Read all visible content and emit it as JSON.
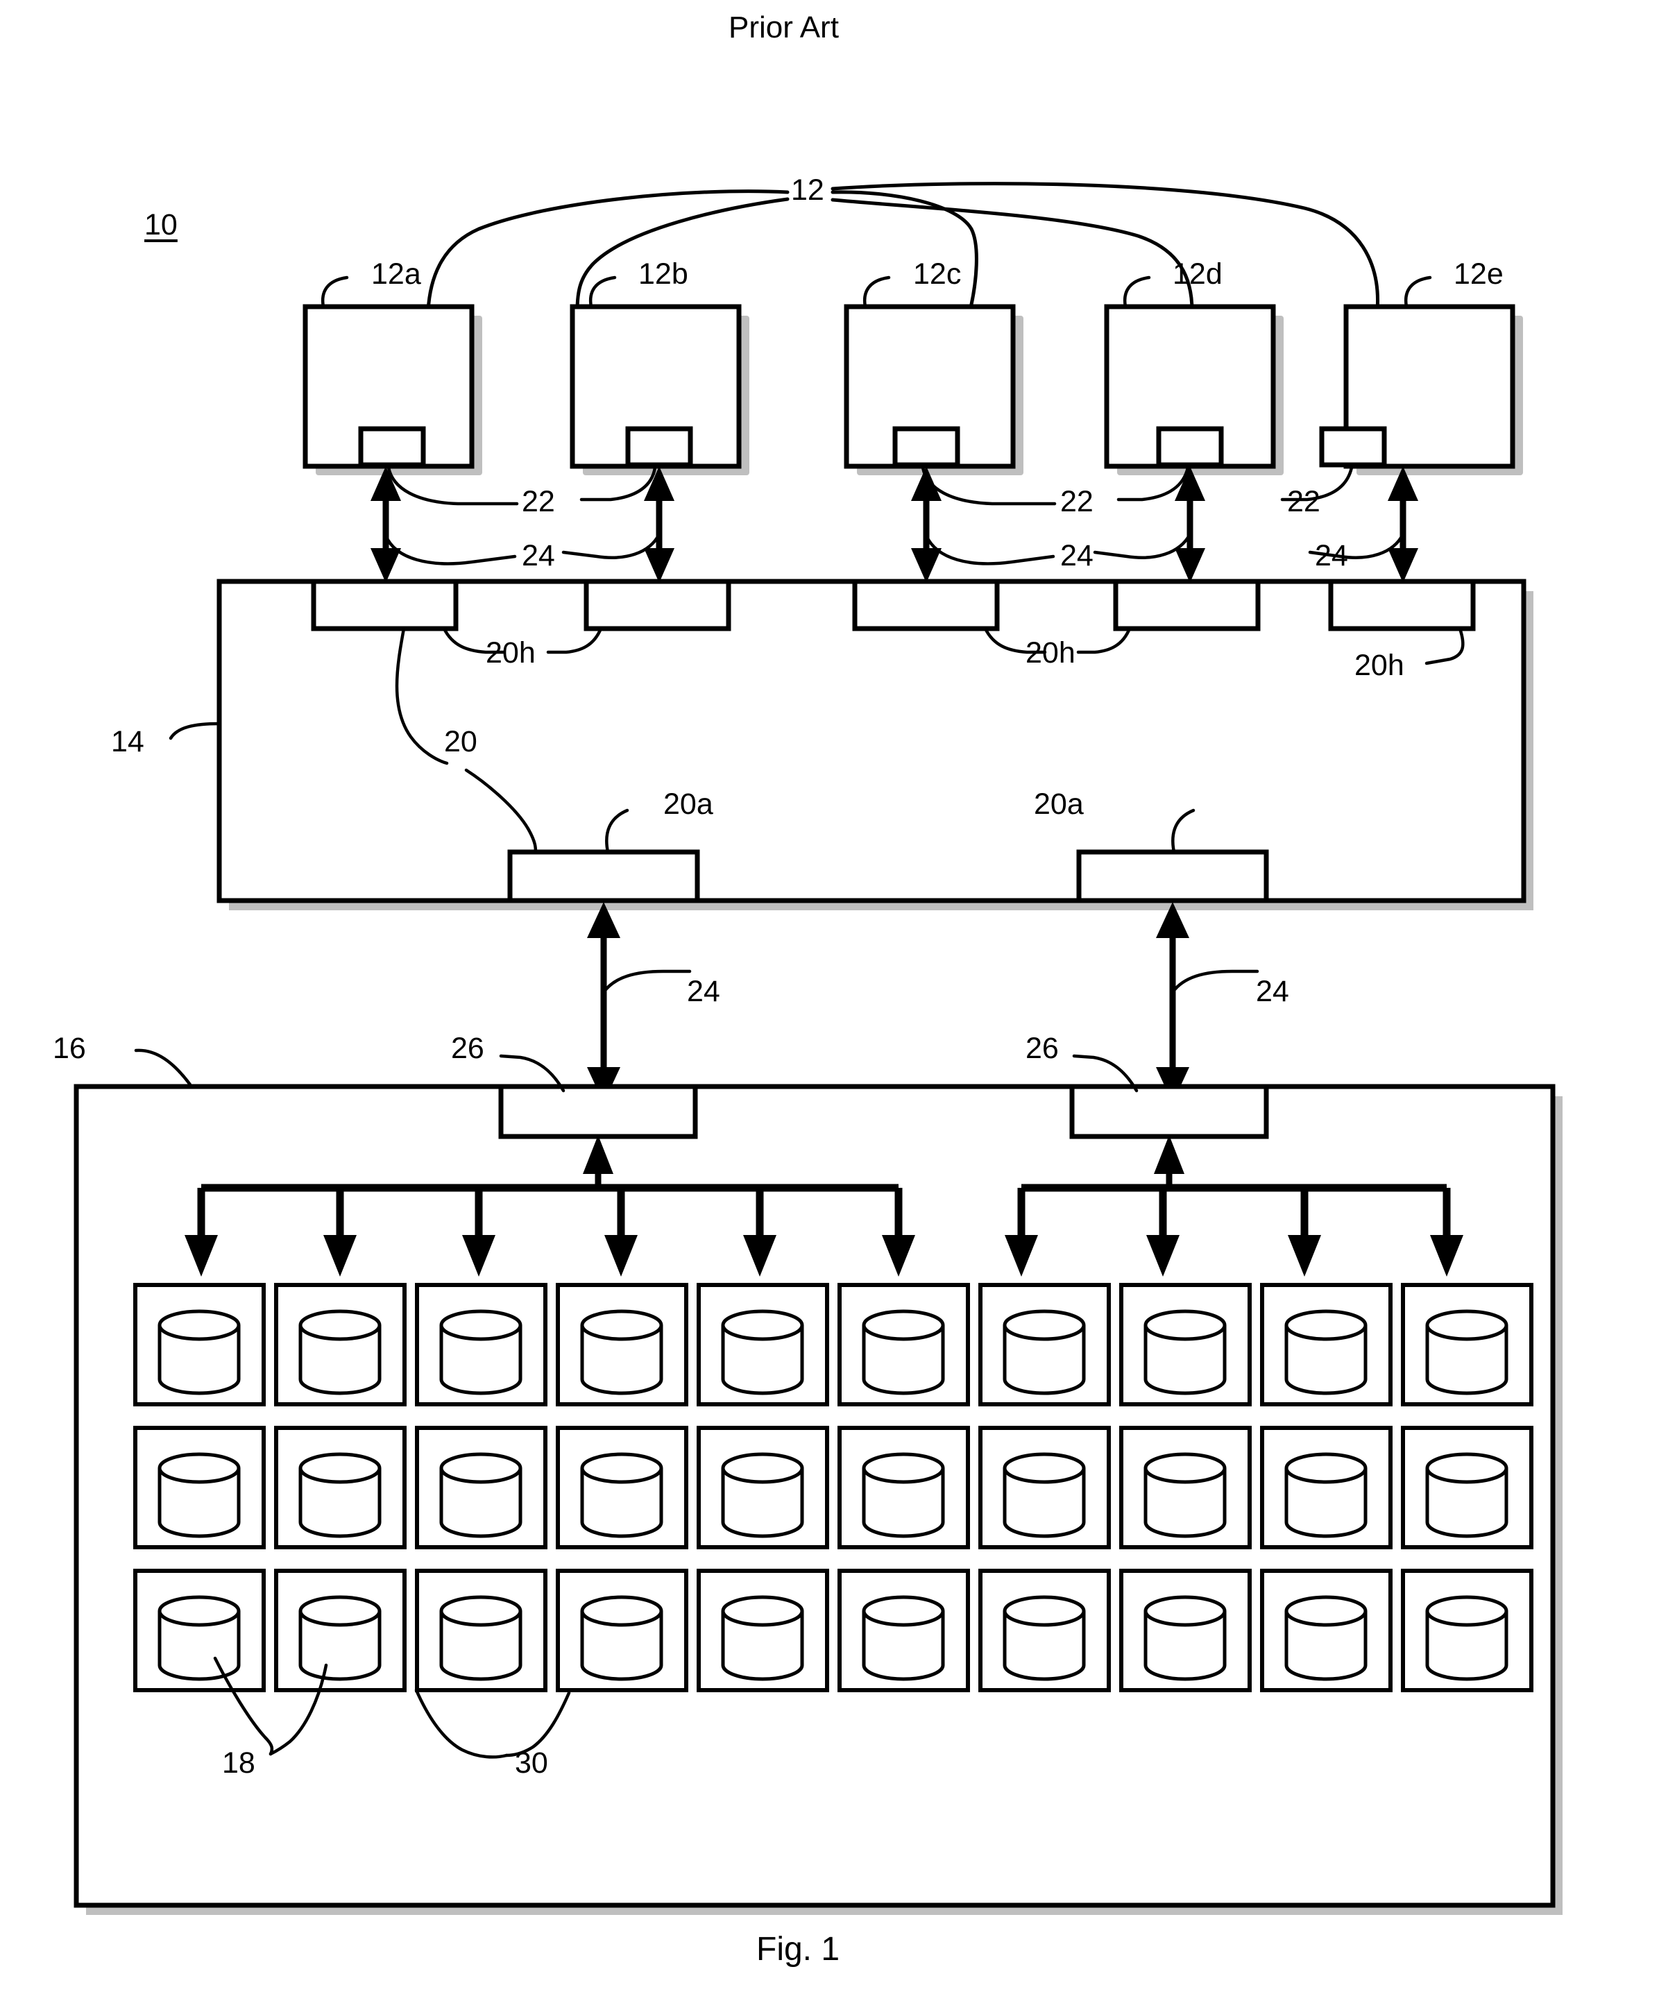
{
  "figure": {
    "title": "Prior Art",
    "caption": "Fig. 1",
    "system_label": "10"
  },
  "reference_numerals": {
    "system": "10",
    "terminal_group": "12",
    "terminals": [
      "12a",
      "12b",
      "12c",
      "12d",
      "12e"
    ],
    "server": "14",
    "storage_subsystem": "16",
    "disk": "18",
    "controller": "20",
    "host_port": "20h",
    "storage_port": "20a",
    "terminal_interface": "22",
    "link": "24",
    "storage_interface": "26",
    "disk_enclosure": "30"
  },
  "top_hub": {
    "label": "12"
  },
  "terminals": [
    {
      "id": "terminal-a",
      "label": "12a"
    },
    {
      "id": "terminal-b",
      "label": "12b"
    },
    {
      "id": "terminal-c",
      "label": "12c"
    },
    {
      "id": "terminal-d",
      "label": "12d"
    },
    {
      "id": "terminal-e",
      "label": "12e"
    }
  ],
  "terminal_interface_labels": [
    {
      "label": "22"
    },
    {
      "label": "22"
    },
    {
      "label": "22"
    }
  ],
  "terminal_link_labels": [
    {
      "label": "24"
    },
    {
      "label": "24"
    },
    {
      "label": "24"
    }
  ],
  "server": {
    "label": "14",
    "controller_label": "20",
    "host_ports": [
      {
        "label": "20h"
      },
      {
        "label": "20h"
      },
      {
        "label": "20h"
      }
    ],
    "storage_ports": [
      {
        "label": "20a"
      },
      {
        "label": "20a"
      }
    ]
  },
  "server_link_labels": [
    {
      "label": "24"
    },
    {
      "label": "24"
    }
  ],
  "storage": {
    "label": "16",
    "interfaces": [
      {
        "label": "26"
      },
      {
        "label": "26"
      }
    ],
    "disk_label": "18",
    "enclosure_label": "30",
    "grid": {
      "columns": 10,
      "rows": 3,
      "left_group_columns": 6,
      "right_group_columns": 4
    }
  },
  "colors": {
    "ink": "#000000",
    "paper": "#ffffff",
    "shadow": "#8b8b8b"
  }
}
